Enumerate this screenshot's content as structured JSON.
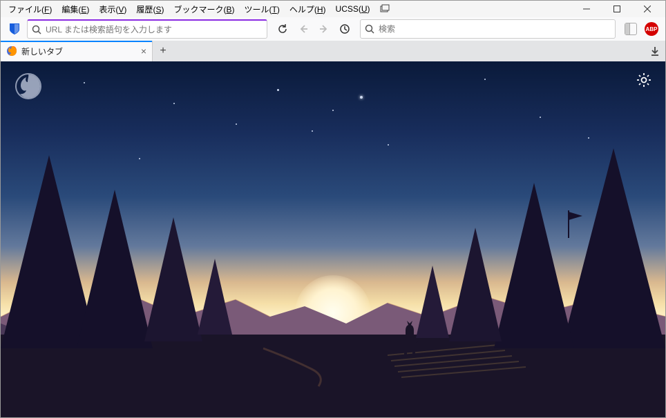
{
  "menubar": {
    "items": [
      {
        "label": "ファイル",
        "key": "F"
      },
      {
        "label": "編集",
        "key": "E"
      },
      {
        "label": "表示",
        "key": "V"
      },
      {
        "label": "履歴",
        "key": "S"
      },
      {
        "label": "ブックマーク",
        "key": "B"
      },
      {
        "label": "ツール",
        "key": "T"
      },
      {
        "label": "ヘルプ",
        "key": "H"
      },
      {
        "label": "UCSS",
        "key": "U"
      }
    ]
  },
  "window_controls": {
    "minimize": "—",
    "maximize": "▢",
    "close": "✕"
  },
  "urlbar": {
    "placeholder": "URL または検索語句を入力します",
    "value": ""
  },
  "searchbar": {
    "placeholder": "検索",
    "value": ""
  },
  "tab": {
    "title": "新しいタブ"
  },
  "icons": {
    "search": "search-icon",
    "reload": "reload-icon",
    "back": "back-icon",
    "forward": "forward-icon",
    "clock": "clock-icon",
    "panel": "panel-icon",
    "abp": "ABP",
    "bitwarden": "bitwarden-icon",
    "restore_window": "restore-window-icon",
    "newtab": "+",
    "close_tab": "×",
    "download": "download-icon",
    "firefox": "firefox-icon",
    "gear": "gear-icon"
  },
  "colors": {
    "tab_highlight": "#0a84ff",
    "urlbar_accent": "#8a2be2",
    "abp_red": "#d40000",
    "bitwarden_blue": "#175ddc"
  }
}
